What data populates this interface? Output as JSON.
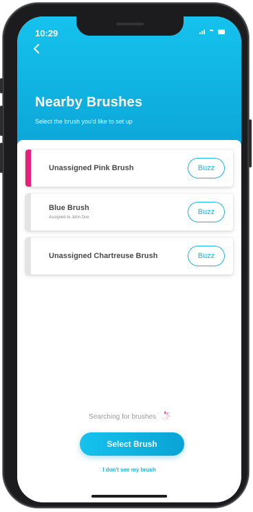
{
  "status_bar": {
    "time": "10:29"
  },
  "header": {
    "title": "Nearby Brushes",
    "subtitle": "Select the brush you'd like to set up"
  },
  "brushes": [
    {
      "name": "Unassigned Pink Brush",
      "assigned": "",
      "accent": "#e91e7a",
      "buzz_label": "Buzz"
    },
    {
      "name": "Blue Brush",
      "assigned": "Assigned to John Doe",
      "accent": "#e4e4e4",
      "buzz_label": "Buzz"
    },
    {
      "name": "Unassigned Chartreuse Brush",
      "assigned": "",
      "accent": "#e4e4e4",
      "buzz_label": "Buzz"
    }
  ],
  "footer": {
    "searching_text": "Searching for brushes",
    "select_button": "Select Brush",
    "help_link": "I don't see my brush"
  },
  "colors": {
    "primary": "#16c2ee",
    "pink_accent": "#e91e7a"
  },
  "icons": {
    "back": "chevron-left-icon",
    "spinner": "loading-spinner-icon"
  }
}
